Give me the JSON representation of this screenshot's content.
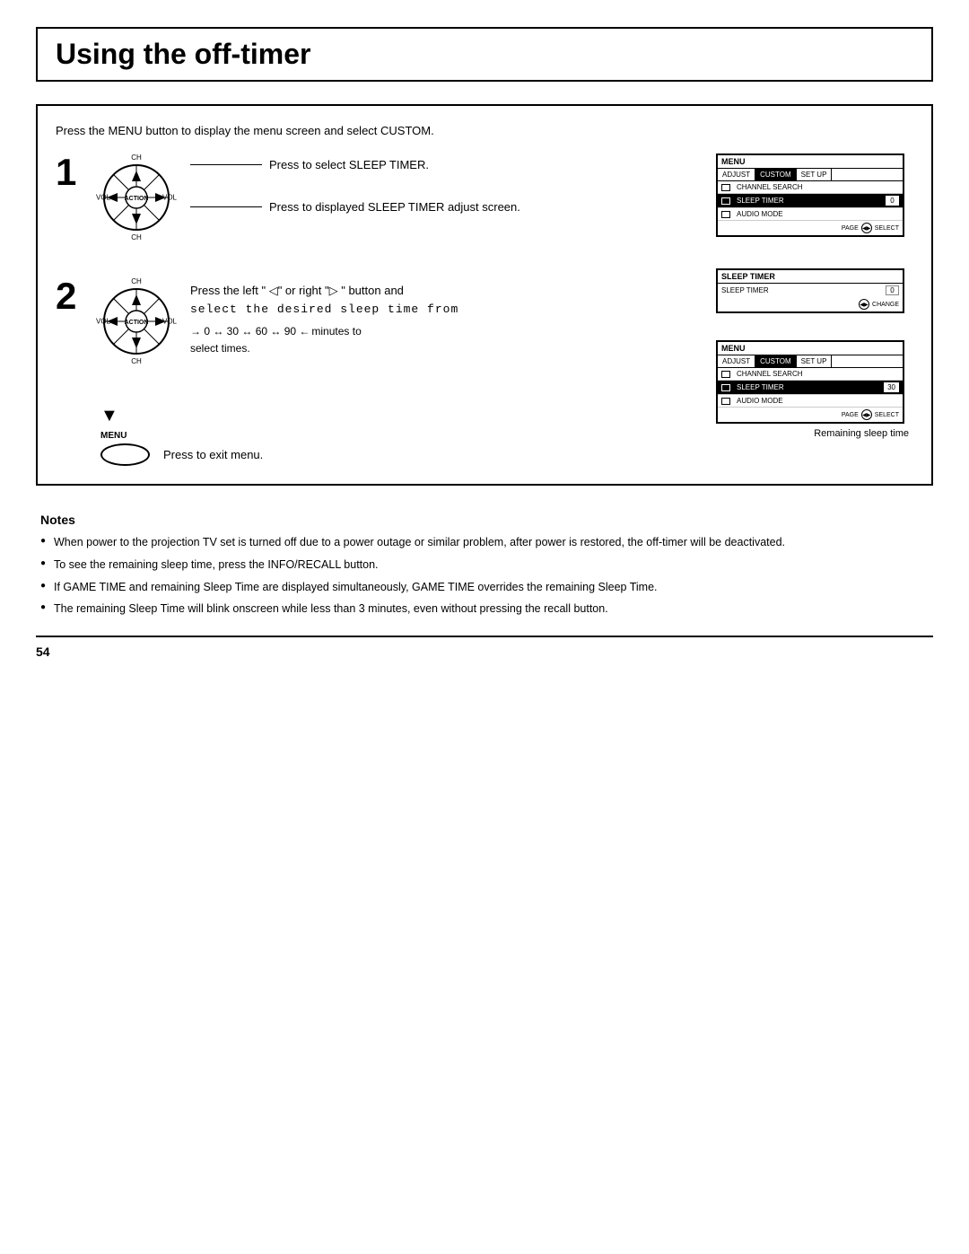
{
  "page": {
    "title": "Using the off-timer",
    "page_number": "54"
  },
  "intro": {
    "text": "Press the MENU button to display the menu screen and select CUSTOM."
  },
  "steps": [
    {
      "number": "1",
      "instructions": [
        "Press to select SLEEP TIMER.",
        "Press to displayed SLEEP TIMER adjust screen."
      ]
    },
    {
      "number": "2",
      "instructions": [
        "Press the left \"◁\" or right \"▷ \" button and select the desired sleep time from",
        "→ 0 ↔ 30 ↔ 60 ↔ 90 ← minutes to select times."
      ]
    }
  ],
  "menu_step": {
    "label": "MENU",
    "instruction": "Press to exit menu."
  },
  "screen_menu_1": {
    "title": "MENU",
    "tabs": [
      "ADJUST",
      "CUSTOM",
      "SET UP"
    ],
    "active_tab": "CUSTOM",
    "rows": [
      {
        "icon": "tv",
        "label": "CHANNEL SEARCH",
        "value": "",
        "highlighted": false
      },
      {
        "icon": "timer",
        "label": "SLEEP TIMER",
        "value": "0",
        "highlighted": true
      },
      {
        "icon": "audio",
        "label": "AUDIO MODE",
        "value": "",
        "highlighted": false
      }
    ],
    "footer": "PAGE ◄ACTION► SELECT"
  },
  "sleep_timer_screen": {
    "title": "SLEEP TIMER",
    "row_label": "SLEEP TIMER",
    "row_value": "0",
    "footer": "◄► CHANGE"
  },
  "screen_menu_2": {
    "title": "MENU",
    "tabs": [
      "ADJUST",
      "CUSTOM",
      "SET UP"
    ],
    "active_tab": "CUSTOM",
    "rows": [
      {
        "icon": "tv",
        "label": "CHANNEL SEARCH",
        "value": "",
        "highlighted": false
      },
      {
        "icon": "timer",
        "label": "SLEEP TIMER",
        "value": "30",
        "highlighted": true
      },
      {
        "icon": "audio",
        "label": "AUDIO MODE",
        "value": "",
        "highlighted": false
      }
    ],
    "footer": "PAGE ◄ACTION► SELECT",
    "remaining_label": "Remaining sleep time"
  },
  "notes": {
    "title": "Notes",
    "items": [
      "When power to the projection TV set is turned off due to a power outage or similar problem, after power is restored, the off-timer will be deactivated.",
      "To see the remaining sleep time, press the INFO/RECALL button.",
      "If GAME TIME and remaining Sleep Time are displayed simultaneously, GAME TIME overrides the remaining Sleep Time.",
      "The remaining Sleep Time will blink onscreen while less than 3 minutes, even without pressing the recall button."
    ]
  }
}
